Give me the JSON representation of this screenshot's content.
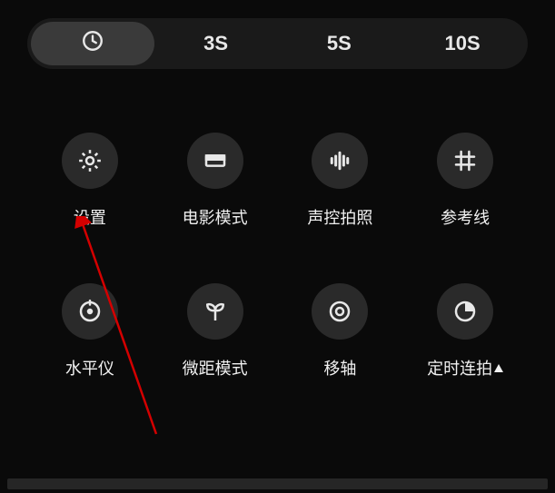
{
  "timer": {
    "items": [
      {
        "label": "",
        "icon": "clock",
        "active": true
      },
      {
        "label": "3S",
        "icon": null,
        "active": false
      },
      {
        "label": "5S",
        "icon": null,
        "active": false
      },
      {
        "label": "10S",
        "icon": null,
        "active": false
      }
    ]
  },
  "grid": {
    "items": [
      {
        "icon": "gear",
        "label": "设置",
        "indicator": false
      },
      {
        "icon": "movie",
        "label": "电影模式",
        "indicator": false
      },
      {
        "icon": "soundwave",
        "label": "声控拍照",
        "indicator": false
      },
      {
        "icon": "grid-hash",
        "label": "参考线",
        "indicator": false
      },
      {
        "icon": "level",
        "label": "水平仪",
        "indicator": false
      },
      {
        "icon": "macro",
        "label": "微距模式",
        "indicator": false
      },
      {
        "icon": "tilt-shift",
        "label": "移轴",
        "indicator": false
      },
      {
        "icon": "timer-c",
        "label": "定时连拍",
        "indicator": true
      }
    ]
  },
  "annotation": {
    "arrow_color": "#d40000"
  }
}
